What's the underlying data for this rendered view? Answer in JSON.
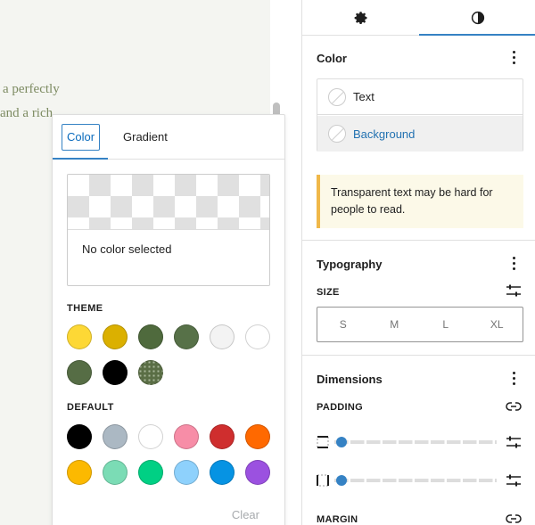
{
  "canvas": {
    "line1": "a perfectly",
    "line2": "and a rich"
  },
  "popover": {
    "tabs": [
      "Color",
      "Gradient"
    ],
    "preview_text": "No color selected",
    "theme_label": "THEME",
    "default_label": "DEFAULT",
    "clear_label": "Clear",
    "theme_colors": [
      "#fdd835",
      "#dbb000",
      "#4f6a3d",
      "#577148",
      "#f3f3f3",
      "#ffffff",
      "#566d45",
      "#000000",
      "pattern"
    ],
    "default_colors": [
      "#000000",
      "#abb8c3",
      "#ffffff",
      "#f78da7",
      "#cf2e2e",
      "#ff6900",
      "#fcb900",
      "#7bdcb5",
      "#00d084",
      "#8ed1fc",
      "#0693e3",
      "#9b51e0"
    ]
  },
  "sidebar": {
    "tabs": [
      "settings-icon",
      "styles-icon"
    ],
    "color": {
      "title": "Color",
      "items": [
        "Text",
        "Background"
      ],
      "notice": "Transparent text may be hard for people to read."
    },
    "typography": {
      "title": "Typography",
      "size_label": "SIZE",
      "sizes": [
        "S",
        "M",
        "L",
        "XL"
      ]
    },
    "dimensions": {
      "title": "Dimensions",
      "padding_label": "PADDING",
      "margin_label": "MARGIN"
    }
  },
  "colors": {
    "accent": "#3582c4",
    "link": "#2271b1",
    "notice_border": "#f0b849"
  }
}
